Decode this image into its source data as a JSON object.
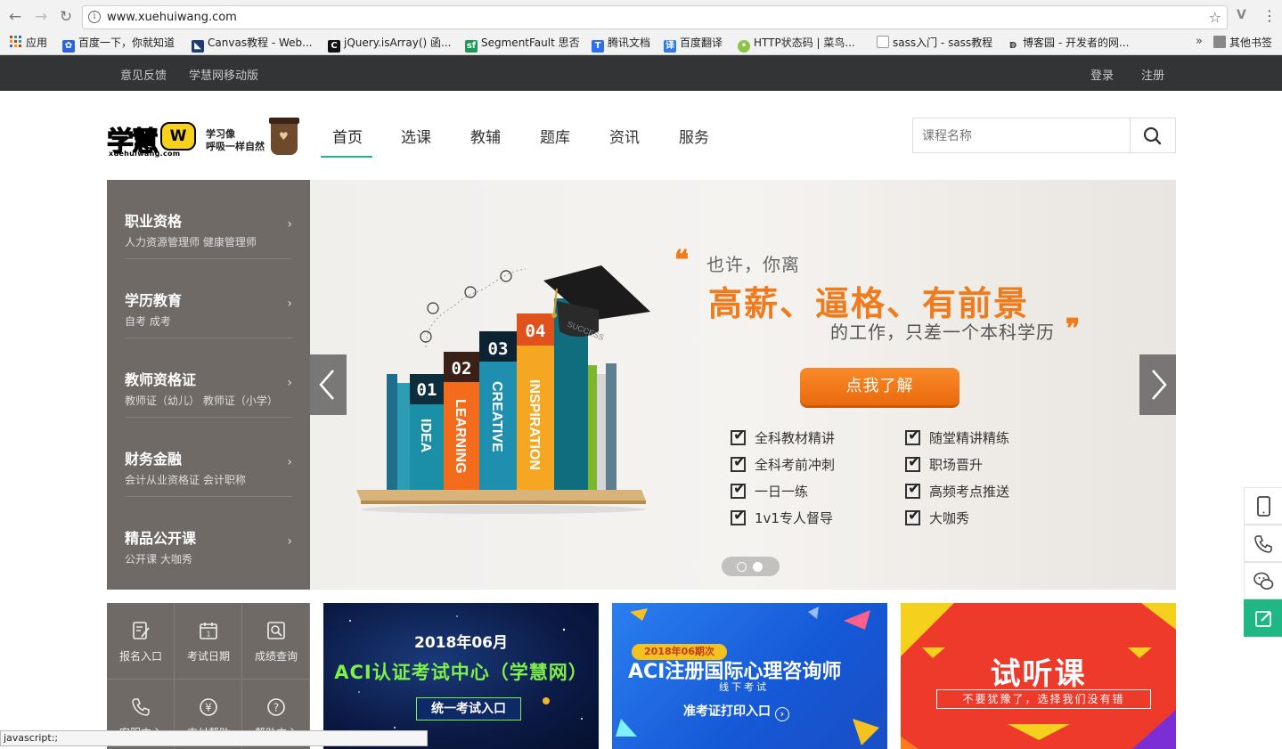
{
  "browser": {
    "url": "www.xuehuiwang.com",
    "bookmarks": [
      {
        "label": "应用",
        "icon": "apps-grid-icon"
      },
      {
        "label": "百度一下，你就知道",
        "icon": "baidu-paw-icon"
      },
      {
        "label": "Canvas教程 - Web...",
        "icon": "canvas-icon"
      },
      {
        "label": "jQuery.isArray() 函...",
        "icon": "codeplayer-icon"
      },
      {
        "label": "SegmentFault 思否",
        "icon": "segmentfault-icon"
      },
      {
        "label": "腾讯文档",
        "icon": "tencent-docs-icon"
      },
      {
        "label": "百度翻译",
        "icon": "baidu-translate-icon"
      },
      {
        "label": "HTTP状态码 | 菜鸟...",
        "icon": "runoob-icon"
      },
      {
        "label": "sass入门 - sass教程",
        "icon": "page-icon"
      },
      {
        "label": "博客园 - 开发者的网...",
        "icon": "cnblogs-icon"
      }
    ],
    "more_bookmarks": "»",
    "other_bookmarks": "其他书签",
    "status_text": "javascript:;"
  },
  "topbar": {
    "feedback": "意见反馈",
    "mobile": "学慧网移动版",
    "login": "登录",
    "register": "注册"
  },
  "logo": {
    "wordmark": "学慧",
    "tv_letter": "W",
    "domain": "xuehuiwang.com",
    "slogan_line1": "学习像",
    "slogan_line2": "呼吸一样自然"
  },
  "nav": {
    "items": [
      "首页",
      "选课",
      "教辅",
      "题库",
      "资讯",
      "服务"
    ],
    "active_index": 0
  },
  "search": {
    "placeholder": "课程名称"
  },
  "categories": [
    {
      "title": "职业资格",
      "sub": "人力资源管理师  健康管理师"
    },
    {
      "title": "学历教育",
      "sub": "自考  成考"
    },
    {
      "title": "教师资格证",
      "sub": "教师证（幼儿）  教师证（小学）"
    },
    {
      "title": "财务金融",
      "sub": "会计从业资格证  会计职称"
    },
    {
      "title": "精品公开课",
      "sub": "公开课  大咖秀"
    }
  ],
  "banner": {
    "line1": "也许，你离",
    "line2": "高薪、逼格、有前景",
    "line3": "的工作，只差一个本科学历",
    "cta": "点我了解",
    "features_left": [
      "全科教材精讲",
      "全科考前冲刺",
      "一日一练",
      "1v1专人督导"
    ],
    "features_right": [
      "随堂精讲精练",
      "职场晋升",
      "高频考点推送",
      "大咖秀"
    ],
    "books": [
      {
        "num": "01",
        "word": "IDEA"
      },
      {
        "num": "02",
        "word": "LEARNING"
      },
      {
        "num": "03",
        "word": "CREATIVE"
      },
      {
        "num": "04",
        "word": "INSPIRATION"
      }
    ],
    "cap_text": "SUCCESS",
    "slide_count": 2,
    "active_slide": 1
  },
  "quick": [
    {
      "label": "报名入口",
      "icon": "signup-icon"
    },
    {
      "label": "考试日期",
      "icon": "calendar-icon"
    },
    {
      "label": "成绩查询",
      "icon": "search-score-icon"
    },
    {
      "label": "客服中心",
      "icon": "phone-icon"
    },
    {
      "label": "支付帮助",
      "icon": "yen-icon"
    },
    {
      "label": "帮助中心",
      "icon": "help-icon"
    }
  ],
  "cards": {
    "card1": {
      "date": "2018年06月",
      "title": "ACI认证考试中心（学慧网）",
      "button": "统一考试入口"
    },
    "card2": {
      "tag": "2018年06期次",
      "title": "ACI注册国际心理咨询师",
      "sub": "线下考试",
      "button": "准考证打印入口"
    },
    "card3": {
      "title": "试听课",
      "sub": "不要犹豫了，选择我们没有错"
    }
  },
  "colors": {
    "accent": "#1fb784",
    "orange": "#f07b1c",
    "topbar": "#333435",
    "menu": "#6f6a66"
  }
}
